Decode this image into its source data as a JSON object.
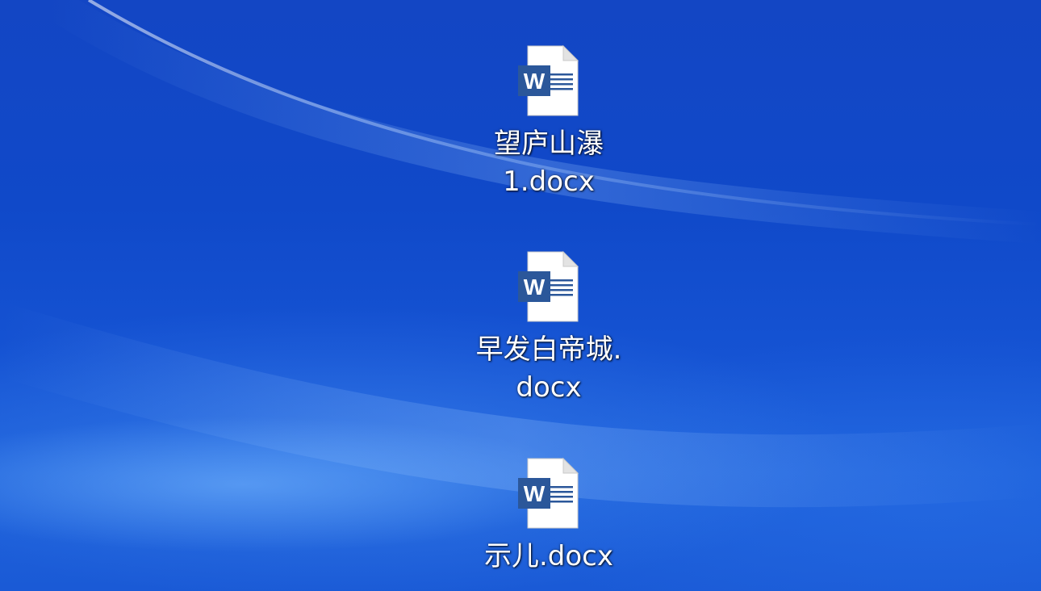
{
  "desktop": {
    "icons": [
      {
        "line1": "望庐山瀑",
        "line2": "1.docx",
        "icon": "word-document-icon"
      },
      {
        "line1": "早发白帝城.",
        "line2": "docx",
        "icon": "word-document-icon"
      },
      {
        "line1": "示儿.docx",
        "line2": "",
        "icon": "word-document-icon"
      }
    ],
    "icon_badge_letter": "W",
    "colors": {
      "word_blue": "#2b579a",
      "word_blue_dark": "#1e4585",
      "page_white": "#ffffff",
      "wallpaper_blue": "#1349c8"
    }
  }
}
